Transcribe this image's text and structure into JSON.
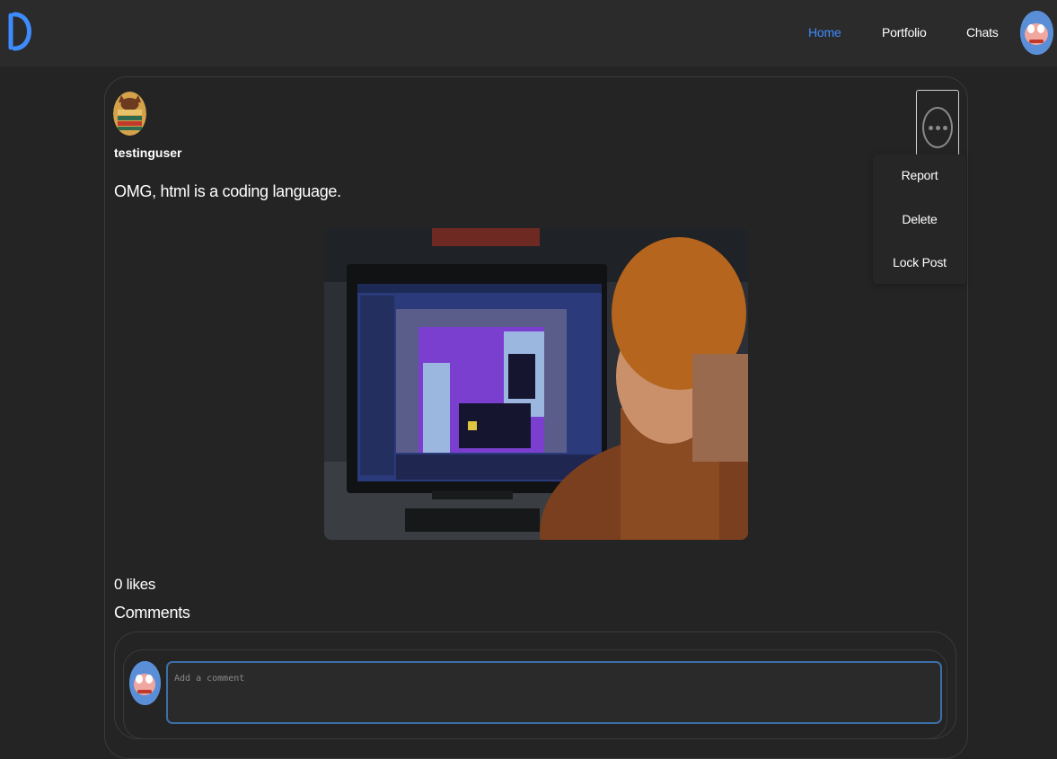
{
  "nav": {
    "links": [
      {
        "label": "Home",
        "active": true
      },
      {
        "label": "Portfolio",
        "active": false
      },
      {
        "label": "Chats",
        "active": false
      }
    ],
    "accent_color": "#3d8bfd"
  },
  "post": {
    "username": "testinguser",
    "text": "OMG, html is a coding language.",
    "likes_text": "0 likes",
    "comments_title": "Comments",
    "menu": {
      "items": [
        "Report",
        "Delete",
        "Lock Post"
      ]
    }
  },
  "comment_form": {
    "placeholder": "Add a comment"
  }
}
